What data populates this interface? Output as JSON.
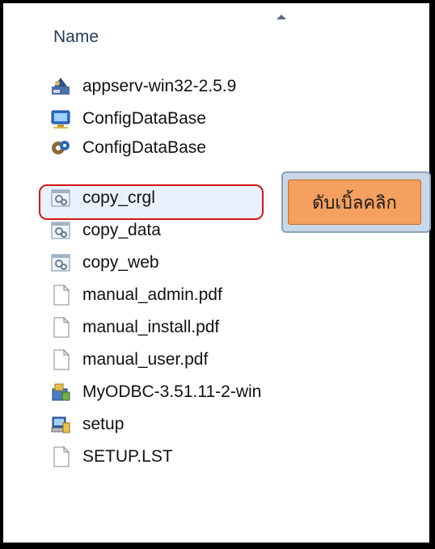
{
  "header": {
    "column_name": "Name",
    "sort_arrow_icon": "sort-ascending-icon"
  },
  "files": [
    {
      "name": "appserv-win32-2.5.9",
      "icon": "installer-icon"
    },
    {
      "name": "ConfigDataBase",
      "icon": "config-monitor-icon"
    },
    {
      "name": "ConfigDataBase",
      "icon": "config-gear-icon"
    },
    {
      "name": "copy_crgl",
      "icon": "batch-file-icon",
      "selected": true
    },
    {
      "name": "copy_data",
      "icon": "batch-file-icon"
    },
    {
      "name": "copy_web",
      "icon": "batch-file-icon"
    },
    {
      "name": "manual_admin.pdf",
      "icon": "blank-file-icon"
    },
    {
      "name": "manual_install.pdf",
      "icon": "blank-file-icon"
    },
    {
      "name": "manual_user.pdf",
      "icon": "blank-file-icon"
    },
    {
      "name": "MyODBC-3.51.11-2-win",
      "icon": "odbc-installer-icon"
    },
    {
      "name": "setup",
      "icon": "setup-computer-icon"
    },
    {
      "name": "SETUP.LST",
      "icon": "blank-file-icon"
    }
  ],
  "callout": {
    "text": "ดับเบิ้ลคลิก"
  },
  "colors": {
    "highlight_border": "#d61818",
    "callout_fill": "#f5a05e"
  }
}
